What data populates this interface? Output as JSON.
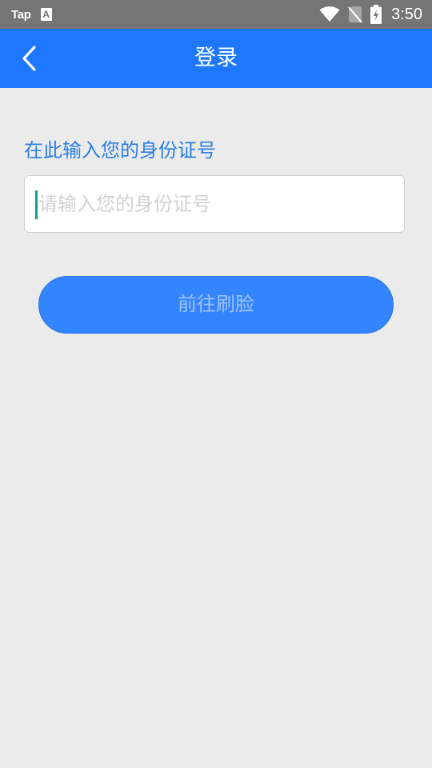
{
  "status_bar": {
    "app_label": "Tap",
    "notification_letter": "A",
    "time": "3:50"
  },
  "app_bar": {
    "title": "登录",
    "background_color": "#1e78ff"
  },
  "form": {
    "label": "在此输入您的身份证号",
    "input_value": "",
    "input_placeholder": "请输入您的身份证号",
    "submit_label": "前往刷脸"
  },
  "colors": {
    "accent": "#2b7fe6",
    "button": "#3385ff",
    "caret": "#159a8c",
    "page_bg": "#ebebeb"
  }
}
